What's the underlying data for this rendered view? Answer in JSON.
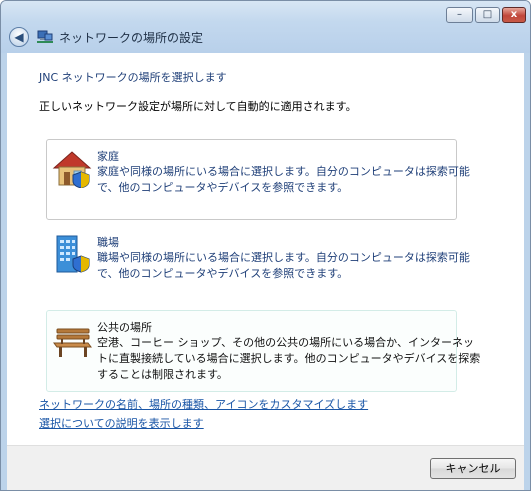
{
  "window": {
    "title": "ネットワークの場所の設定",
    "controls": {
      "minimize": "–",
      "maximize": "□",
      "close": "x"
    }
  },
  "content": {
    "heading": "JNC ネットワークの場所を選択します",
    "intro": "正しいネットワーク設定が場所に対して自動的に適用されます。",
    "options": [
      {
        "title": "家庭",
        "description": "家庭や同様の場所にいる場合に選択します。自分のコンピュータは探索可能\nで、他のコンピュータやデバイスを参照できます。",
        "icon": "house-icon"
      },
      {
        "title": "職場",
        "description": "職場や同様の場所にいる場合に選択します。自分のコンピュータは探索可能\nで、他のコンピュータやデバイスを参照できます。",
        "icon": "office-building-icon"
      },
      {
        "title": "公共の場所",
        "description": "空港、コーヒー ショップ、その他の公共の場所にいる場合か、インターネッ\nトに直製接続している場合に選択します。他のコンピュータやデバイスを探索\nすることは制限されます。",
        "icon": "park-bench-icon"
      }
    ],
    "links": [
      "ネットワークの名前、場所の種類、アイコンをカスタマイズします",
      "選択についての説明を表示します"
    ]
  },
  "footer": {
    "cancel_label": "キャンセル"
  },
  "colors": {
    "title_bar": "#c3d8ee",
    "link_blue": "#1955a6",
    "option_text": "#1f3f78"
  }
}
